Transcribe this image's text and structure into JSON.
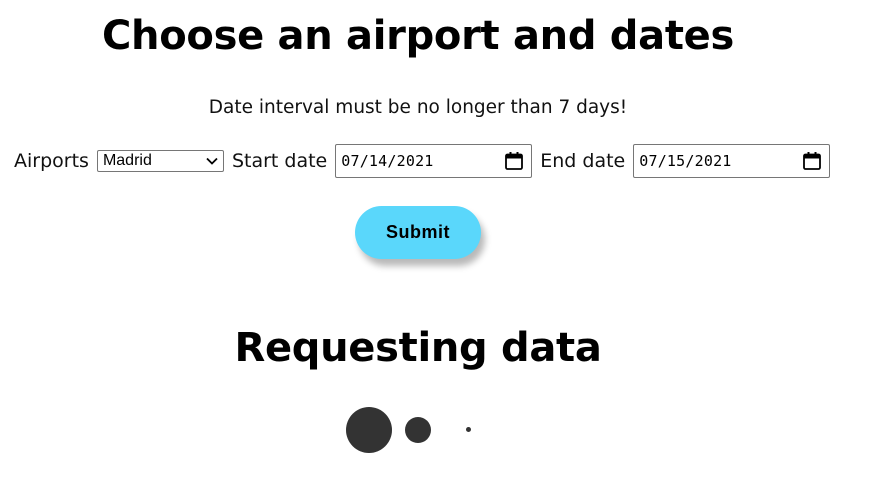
{
  "page": {
    "title": "Choose an airport and dates",
    "notice": "Date interval must be no longer than 7 days!"
  },
  "form": {
    "airports_label": "Airports",
    "airport_selected": "Madrid",
    "start_date_label": "Start date",
    "start_date_value": "07/14/2021",
    "end_date_label": "End date",
    "end_date_value": "07/15/2021",
    "submit_label": "Submit"
  },
  "status": {
    "title": "Requesting data",
    "loader_icon": "loading-dots-icon"
  },
  "colors": {
    "submit_bg": "#5ad7fb",
    "loader_dot": "#333333",
    "text": "#000000"
  }
}
